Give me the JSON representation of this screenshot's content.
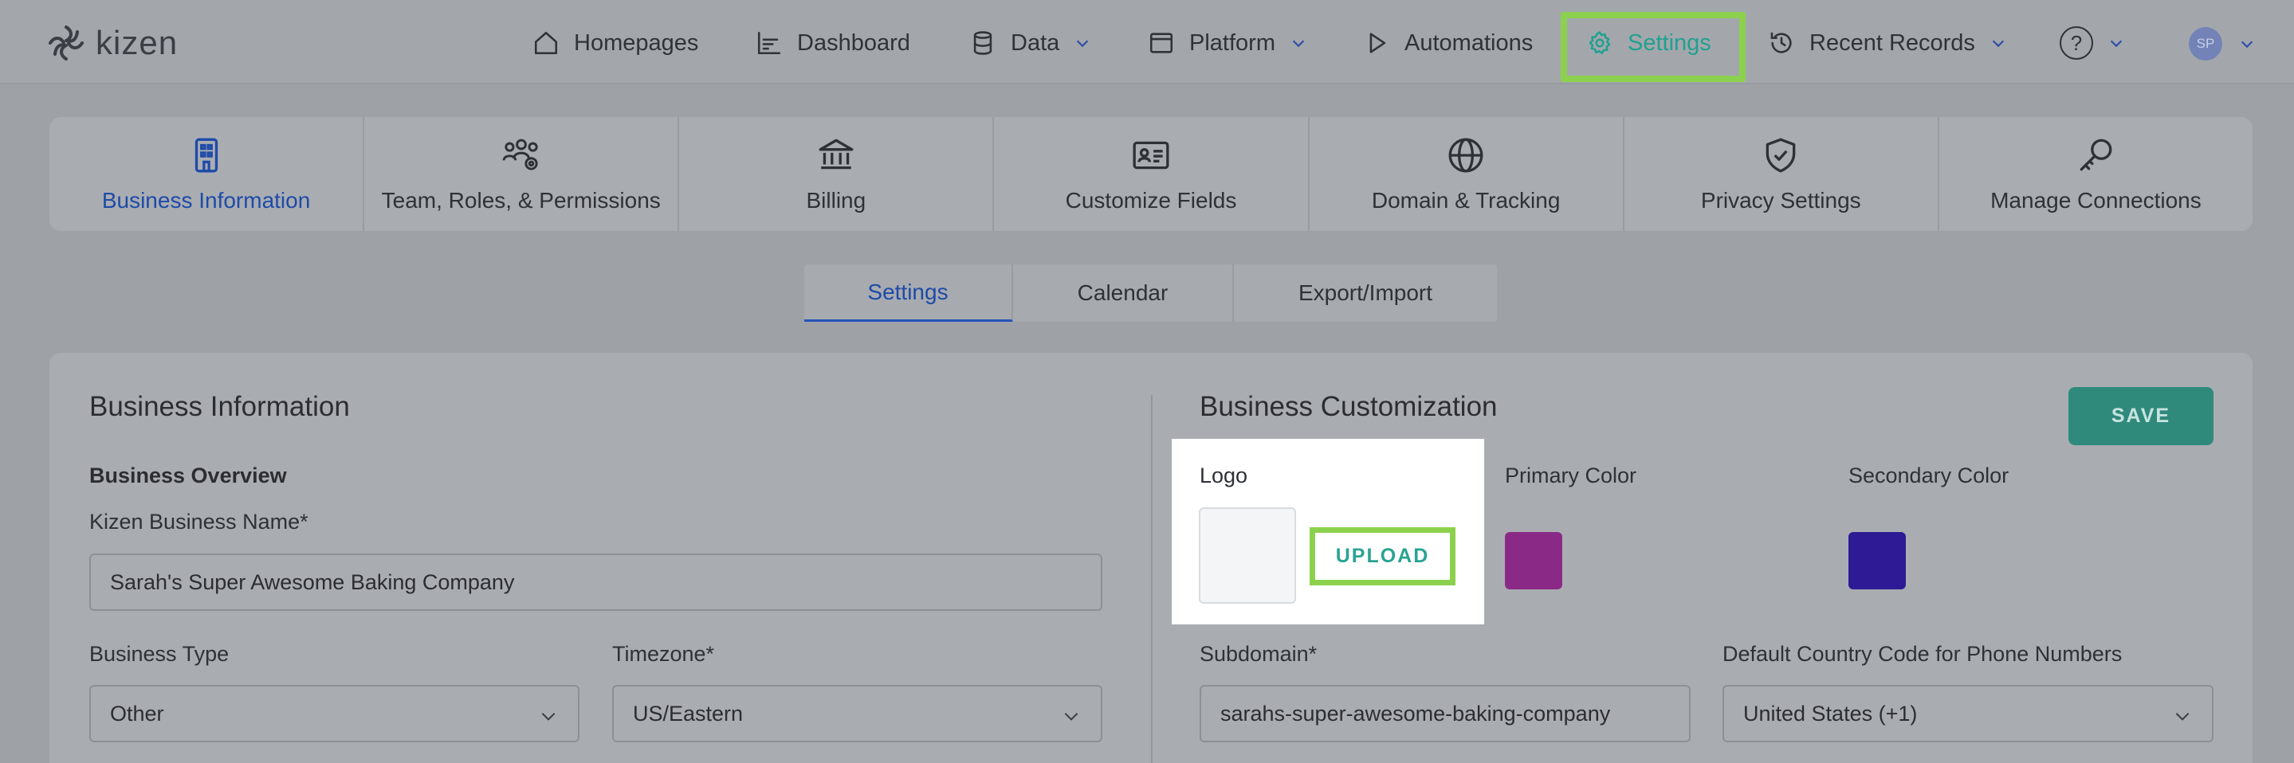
{
  "brand": {
    "name": "kizen"
  },
  "nav": {
    "homepages": "Homepages",
    "dashboard": "Dashboard",
    "data": "Data",
    "platform": "Platform",
    "automations": "Automations",
    "settings": "Settings",
    "recent_records": "Recent Records",
    "help": "?",
    "avatar_initials": "SP"
  },
  "settings_tabs": [
    {
      "label": "Business Information",
      "icon": "building-icon",
      "active": true
    },
    {
      "label": "Team, Roles, & Permissions",
      "icon": "team-icon",
      "active": false
    },
    {
      "label": "Billing",
      "icon": "bank-icon",
      "active": false
    },
    {
      "label": "Customize Fields",
      "icon": "id-card-icon",
      "active": false
    },
    {
      "label": "Domain & Tracking",
      "icon": "globe-icon",
      "active": false
    },
    {
      "label": "Privacy Settings",
      "icon": "shield-icon",
      "active": false
    },
    {
      "label": "Manage Connections",
      "icon": "key-icon",
      "active": false
    }
  ],
  "sub_tabs": [
    {
      "label": "Settings",
      "active": true
    },
    {
      "label": "Calendar",
      "active": false
    },
    {
      "label": "Export/Import",
      "active": false
    }
  ],
  "business_info": {
    "title": "Business Information",
    "overview_heading": "Business Overview",
    "name_label": "Kizen Business Name*",
    "name_value": "Sarah's Super Awesome Baking Company",
    "type_label": "Business Type",
    "type_value": "Other",
    "timezone_label": "Timezone*",
    "timezone_value": "US/Eastern"
  },
  "customization": {
    "title": "Business Customization",
    "save_label": "SAVE",
    "logo_label": "Logo",
    "upload_label": "UPLOAD",
    "primary_color_label": "Primary Color",
    "primary_color": "#8a2a86",
    "secondary_color_label": "Secondary Color",
    "secondary_color": "#2e1a94",
    "subdomain_label": "Subdomain*",
    "subdomain_value": "sarahs-super-awesome-baking-company",
    "country_code_label": "Default Country Code for Phone Numbers",
    "country_code_value": "United States (+1)"
  },
  "colors": {
    "accent": "#8bd14e",
    "active_tab": "#1f4aa8",
    "save_button": "#2f8a7c",
    "upload_text": "#2aa393"
  }
}
